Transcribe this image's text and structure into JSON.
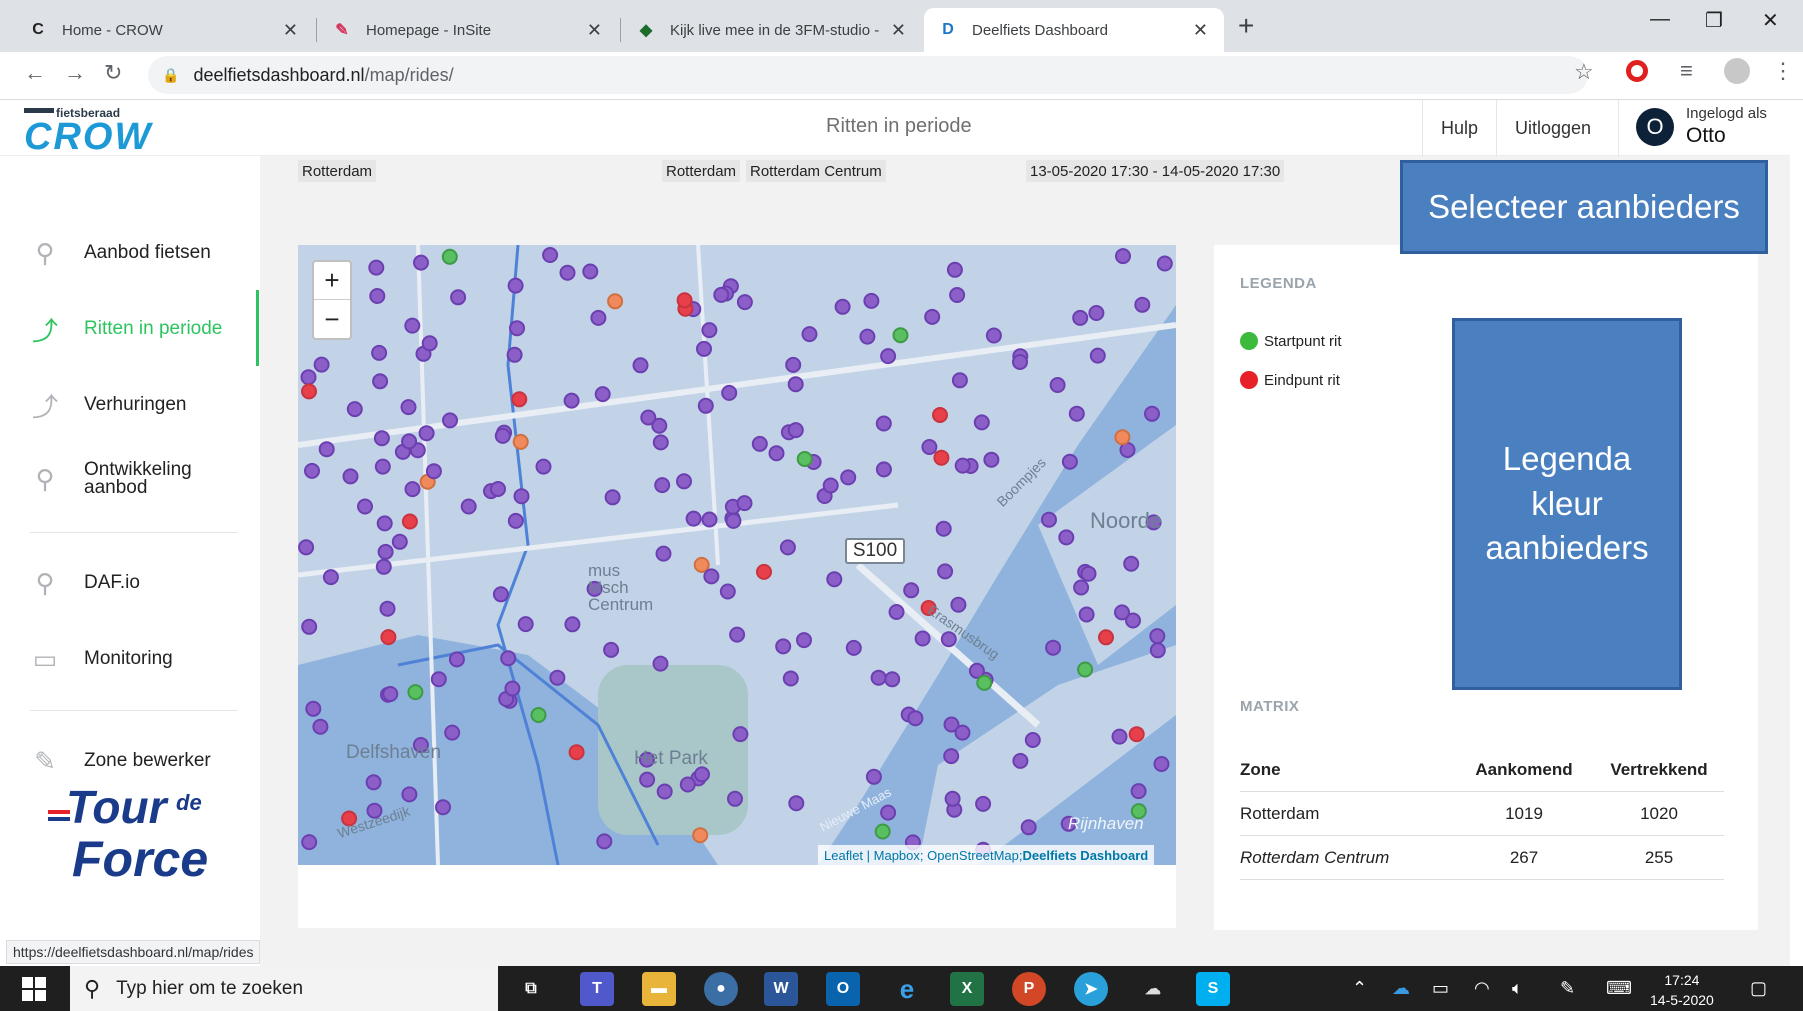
{
  "browser": {
    "tabs": [
      {
        "title": "Home - CROW",
        "favicon": "C"
      },
      {
        "title": "Homepage - InSite",
        "favicon": "pen-icon"
      },
      {
        "title": "Kijk live mee in de 3FM-studio - ",
        "favicon": "diamond-icon"
      },
      {
        "title": "Deelfiets Dashboard",
        "favicon": "D"
      }
    ],
    "url_host": "deelfietsdashboard.nl",
    "url_path": "/map/rides/"
  },
  "header": {
    "logo_small": "fietsberaad",
    "logo_main": "CROW",
    "page_title": "Ritten in periode",
    "help_label": "Hulp",
    "logout_label": "Uitloggen",
    "avatar_letter": "O",
    "logged_in_label": "Ingelogd als",
    "user_name": "Otto"
  },
  "sidebar": {
    "items": [
      {
        "label": "Aanbod fietsen",
        "icon": "map-pin-icon"
      },
      {
        "label": "Ritten in periode",
        "icon": "route-icon"
      },
      {
        "label": "Verhuringen",
        "icon": "route-icon"
      },
      {
        "label": "Ontwikkeling aanbod",
        "icon": "pin-chart-icon"
      },
      {
        "label": "DAF.io",
        "icon": "map-pin-icon"
      },
      {
        "label": "Monitoring",
        "icon": "monitor-chart-icon"
      },
      {
        "label": "Zone bewerker",
        "icon": "pencil-icon"
      }
    ],
    "tour_logo": {
      "line1": "Tour",
      "line2": "de",
      "line3": "Force"
    }
  },
  "filters": {
    "municipality": "Rotterdam",
    "zone1": "Rotterdam",
    "zone2": "Rotterdam Centrum",
    "period": "13-05-2020 17:30 - 14-05-2020 17:30"
  },
  "map": {
    "zoom_in": "+",
    "zoom_out": "−",
    "road_label": "S100",
    "labels": [
      "Noorde",
      "Delfshaven",
      "Het Park",
      "Erasmusbrug",
      "Boompjes",
      "Westzeedijk",
      "Rijnhaven",
      "Nieuwe Maas"
    ],
    "area_label_lines": [
      "mus",
      "Msch",
      "Centrum"
    ],
    "attribution_links": "Leaflet | Mapbox; OpenStreetMap;",
    "attribution_bold": "Deelfiets Dashboard",
    "colors": {
      "water": "#8fb3dd",
      "land": "#c2d3e8",
      "park": "#a9c7c8",
      "dot_purple": "#8c5fc8",
      "dot_green": "#58c060",
      "dot_red": "#e8404a",
      "dot_orange": "#f08a5d"
    }
  },
  "legend": {
    "title": "LEGENDA",
    "start_label": "Startpunt rit",
    "start_color": "#3cba3c",
    "end_label": "Eindpunt rit",
    "end_color": "#e8202a"
  },
  "matrix": {
    "title": "MATRIX",
    "headers": [
      "Zone",
      "Aankomend",
      "Vertrekkend"
    ],
    "rows": [
      {
        "zone": "Rotterdam",
        "incoming": "1019",
        "outgoing": "1020"
      },
      {
        "zone": "Rotterdam Centrum",
        "incoming": "267",
        "outgoing": "255"
      }
    ]
  },
  "callouts": {
    "select_providers": "Selecteer aanbieders",
    "legend_colors_lines": [
      "Legenda",
      "kleur",
      "aanbieders"
    ]
  },
  "statusbar": {
    "hover_url": "https://deelfietsdashboard.nl/map/rides"
  },
  "taskbar": {
    "search_placeholder": "Typ hier om te zoeken",
    "time": "17:24",
    "date": "14-5-2020"
  }
}
